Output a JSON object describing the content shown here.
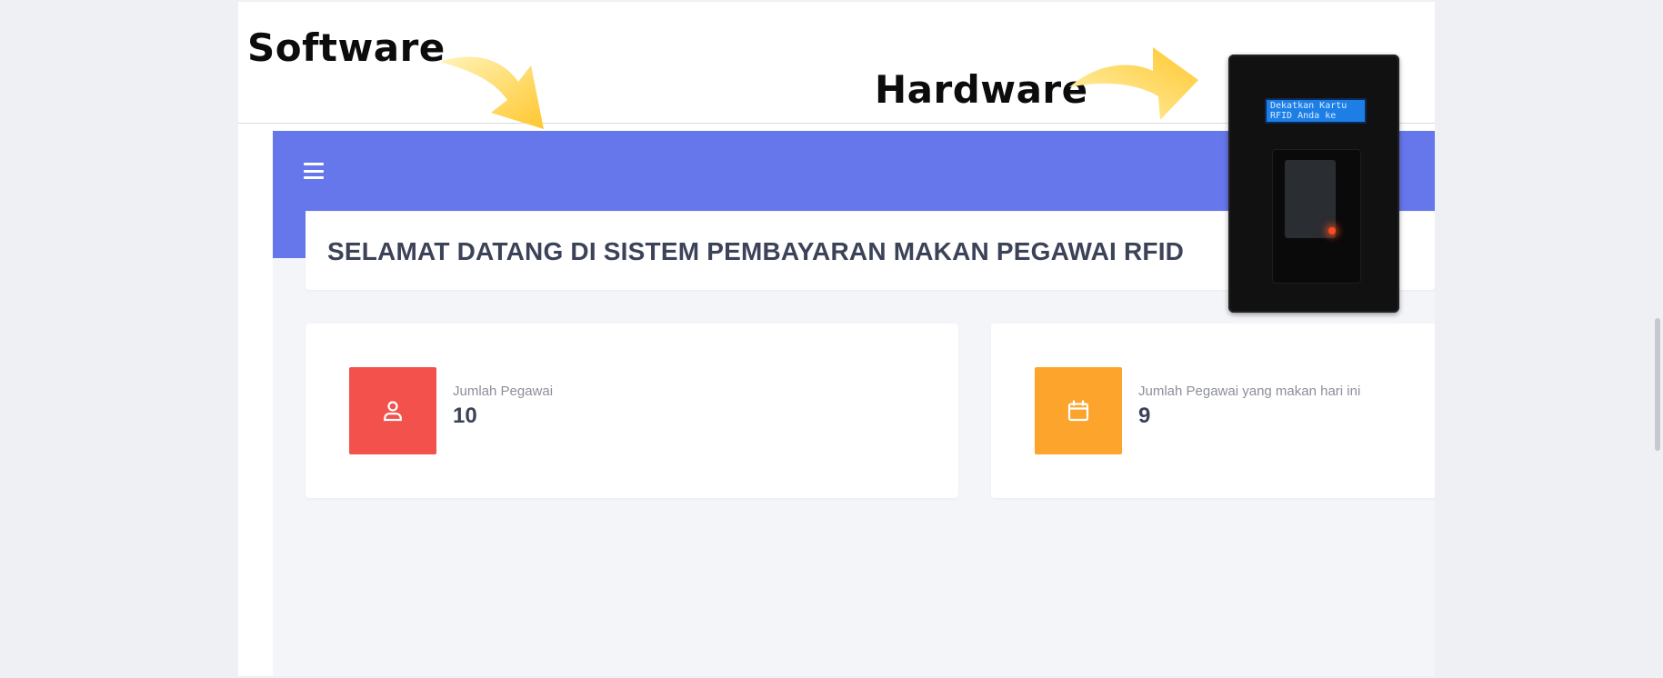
{
  "annotations": {
    "software_label": "Software",
    "hardware_label": "Hardware"
  },
  "app": {
    "welcome_title": "SELAMAT DATANG DI SISTEM PEMBAYARAN MAKAN PEGAWAI RFID",
    "menu_icon": "hamburger-icon",
    "stats": [
      {
        "label": "Jumlah Pegawai",
        "value": "10",
        "icon": "user-icon",
        "color": "#f2514c"
      },
      {
        "label": "Jumlah Pegawai yang makan hari ini",
        "value": "9",
        "icon": "calendar-icon",
        "color": "#fca42b"
      }
    ]
  },
  "device": {
    "lcd_line1": "Dekatkan Kartu",
    "lcd_line2": "RFID Anda ke"
  },
  "colors": {
    "header": "#6677eb",
    "arrow": "#ffd44a"
  }
}
